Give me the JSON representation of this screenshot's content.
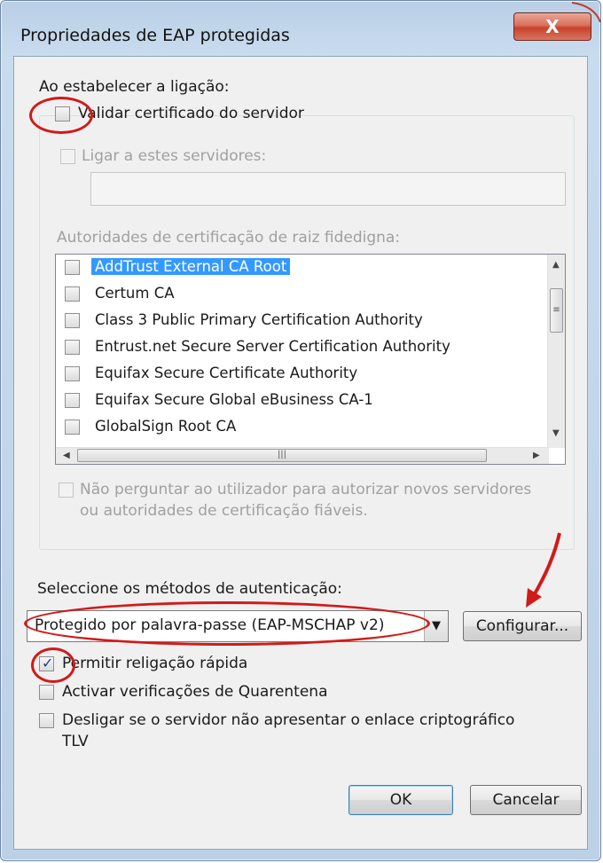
{
  "window": {
    "title": "Propriedades de EAP protegidas",
    "close_glyph": "X"
  },
  "connect": {
    "heading": "Ao estabelecer a ligação:",
    "validate_cert": {
      "label": "Validar certificado do servidor",
      "checked": false
    },
    "connect_servers": {
      "label": "Ligar a estes servidores:",
      "checked": false,
      "value": ""
    },
    "trusted_root_label": "Autoridades de certificação de raiz fidedigna:",
    "ca_list": [
      {
        "label": "AddTrust External CA Root",
        "checked": false,
        "selected": true
      },
      {
        "label": "Certum CA",
        "checked": false,
        "selected": false
      },
      {
        "label": "Class 3 Public Primary Certification Authority",
        "checked": false,
        "selected": false
      },
      {
        "label": "Entrust.net Secure Server Certification Authority",
        "checked": false,
        "selected": false
      },
      {
        "label": "Equifax Secure Certificate Authority",
        "checked": false,
        "selected": false
      },
      {
        "label": "Equifax Secure Global eBusiness CA-1",
        "checked": false,
        "selected": false
      },
      {
        "label": "GlobalSign Root CA",
        "checked": false,
        "selected": false
      }
    ],
    "no_prompt": {
      "line1": "Não perguntar ao utilizador para autorizar novos servidores",
      "line2": "ou autoridades de certificação fiáveis.",
      "checked": false
    }
  },
  "auth": {
    "heading": "Seleccione os métodos de autenticação:",
    "method_value": "Protegido por palavra-passe (EAP-MSCHAP v2)",
    "configure_label": "Configurar...",
    "fast_reconnect": {
      "label": "Permitir religação rápida",
      "checked": true
    },
    "quarantine": {
      "label": "Activar verificações de Quarentena",
      "checked": false
    },
    "disconnect_tlv": {
      "line1": "Desligar se o servidor não apresentar o enlace criptográfico",
      "line2": "TLV",
      "checked": false
    }
  },
  "footer": {
    "ok_label": "OK",
    "cancel_label": "Cancelar"
  },
  "annotation_color": "#d11a1a"
}
